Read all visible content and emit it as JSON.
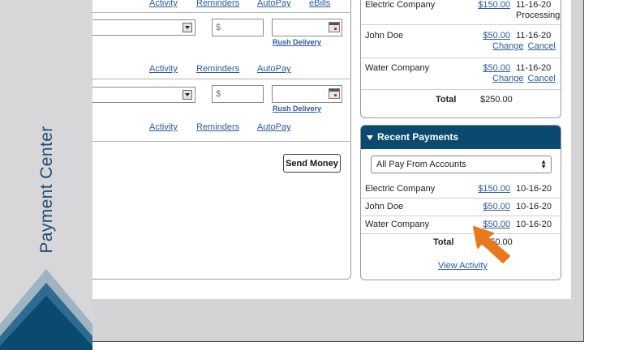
{
  "brand": {
    "title": "Payment Center"
  },
  "pay_bills": {
    "top_links": [
      "Activity",
      "Reminders",
      "AutoPay",
      "eBills"
    ],
    "rows": [
      {
        "amount_placeholder": "$",
        "rush_label": "Rush Delivery",
        "links": [
          "Activity",
          "Reminders",
          "AutoPay"
        ]
      },
      {
        "amount_placeholder": "$",
        "rush_label": "Rush Delivery",
        "links": [
          "Activity",
          "Reminders",
          "AutoPay"
        ]
      }
    ],
    "send_label": "Send Money"
  },
  "pending": {
    "rows": [
      {
        "name": "Electric Company",
        "amount": "$150.00",
        "date": "11-16-20",
        "status": "Processing"
      },
      {
        "name": "John Doe",
        "amount": "$50.00",
        "date": "11-16-20",
        "change": "Change",
        "cancel": "Cancel"
      },
      {
        "name": "Water Company",
        "amount": "$50.00",
        "date": "11-16-20",
        "change": "Change",
        "cancel": "Cancel"
      }
    ],
    "total_label": "Total",
    "total_value": "$250.00"
  },
  "recent": {
    "title": "Recent Payments",
    "account_filter": "All Pay From Accounts",
    "rows": [
      {
        "name": "Electric Company",
        "amount": "$150.00",
        "date": "10-16-20"
      },
      {
        "name": "John Doe",
        "amount": "$50.00",
        "date": "10-16-20"
      },
      {
        "name": "Water Company",
        "amount": "$50.00",
        "date": "10-16-20"
      }
    ],
    "total_label": "Total",
    "total_value": "$250.00",
    "view_activity": "View Activity"
  },
  "colors": {
    "brand_navy": "#0b4a6f",
    "link_blue": "#2c5aa0",
    "pointer_orange": "#e8781e"
  }
}
